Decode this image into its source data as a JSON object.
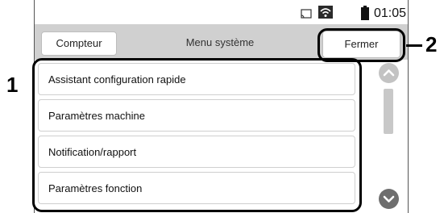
{
  "status_bar": {
    "time": "01:05",
    "icons": [
      "cast-icon",
      "wifi-icon",
      "battery-icon"
    ]
  },
  "header": {
    "counter_label": "Compteur",
    "title": "Menu système",
    "close_label": "Fermer"
  },
  "menu": {
    "items": [
      {
        "label": "Assistant configuration rapide"
      },
      {
        "label": "Paramètres machine"
      },
      {
        "label": "Notification/rapport"
      },
      {
        "label": "Paramètres fonction"
      }
    ]
  },
  "scrollbar": {
    "icons": [
      "chevron-up-icon",
      "chevron-down-icon"
    ]
  },
  "callouts": {
    "list": "1",
    "close": "2"
  },
  "colors": {
    "header_bg": "#d0d0d0",
    "scroll_button": "#6e6e6e"
  }
}
